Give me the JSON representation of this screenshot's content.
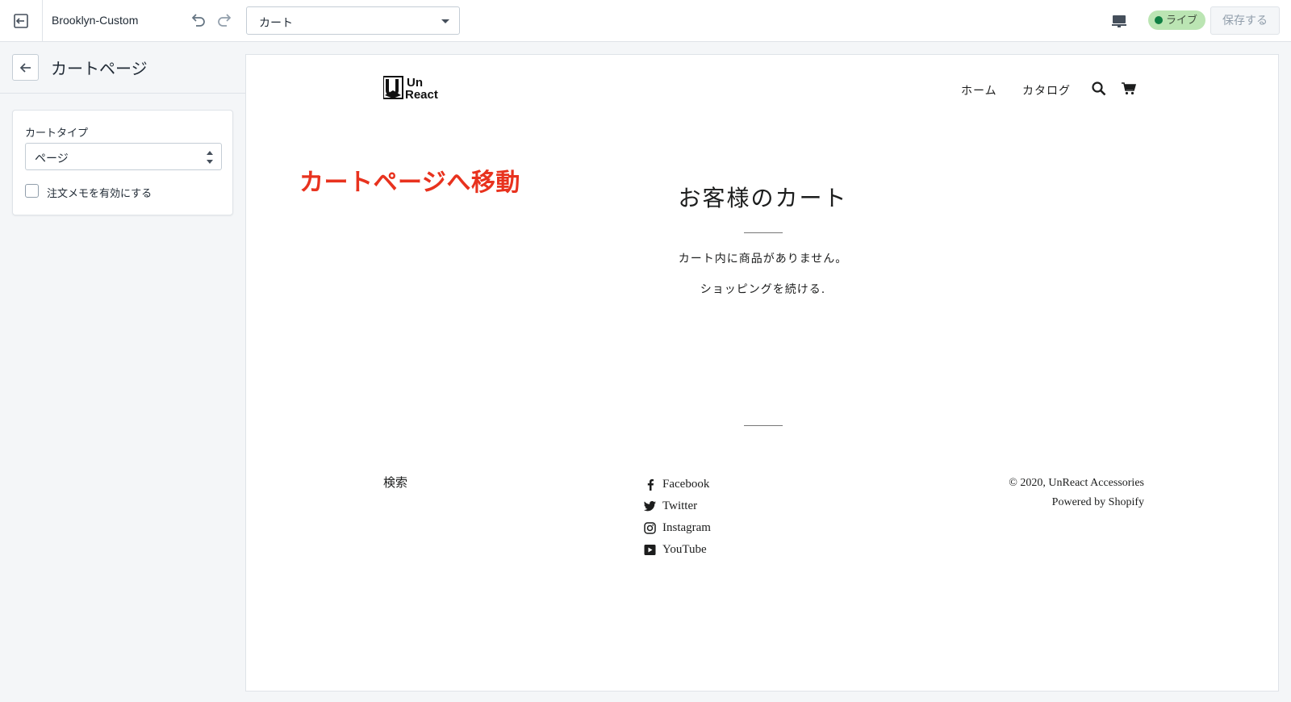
{
  "topbar": {
    "theme_name": "Brooklyn-Custom",
    "page_select": "カート",
    "live_label": "ライブ",
    "save_label": "保存する",
    "live_color": "#108043"
  },
  "sidebar": {
    "title": "カートページ",
    "cart_type_label": "カートタイプ",
    "cart_type_value": "ページ",
    "order_note_label": "注文メモを有効にする",
    "order_note_checked": false
  },
  "preview": {
    "logo_line1": "Un",
    "logo_line2": "React",
    "nav": {
      "home": "ホーム",
      "catalog": "カタログ"
    },
    "annotation": "カートページへ移動",
    "annotation_color": "#e8321e",
    "cart_title": "お客様のカート",
    "empty_message": "カート内に商品がありません。",
    "continue_shopping": "ショッピングを続ける.",
    "footer": {
      "search": "検索",
      "social": [
        "Facebook",
        "Twitter",
        "Instagram",
        "YouTube"
      ],
      "copyright": "© 2020, UnReact Accessories",
      "powered_by": "Powered by Shopify"
    }
  }
}
